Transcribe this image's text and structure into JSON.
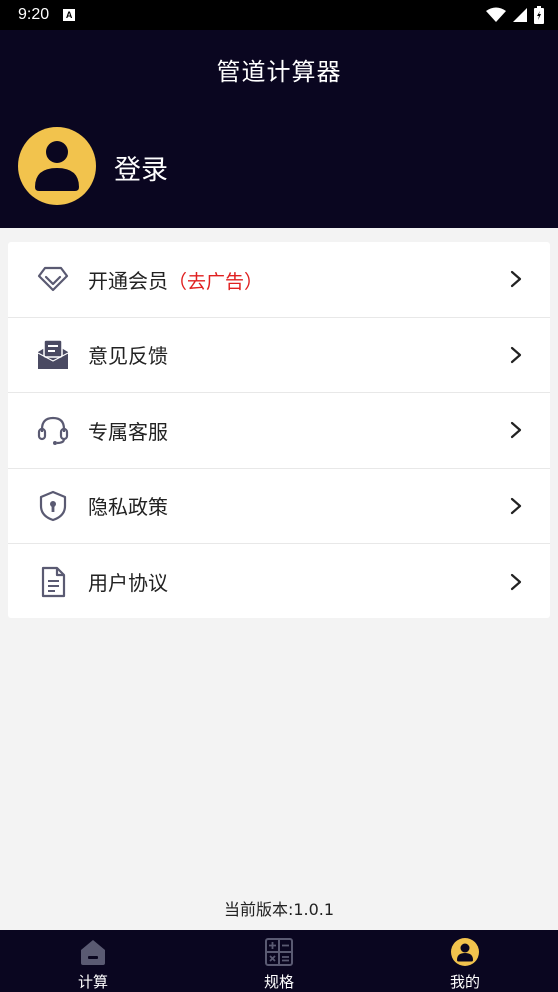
{
  "status_bar": {
    "time": "9:20",
    "a_badge": "A"
  },
  "header": {
    "title": "管道计算器",
    "login_label": "登录"
  },
  "menu": [
    {
      "icon": "diamond-icon",
      "label": "开通会员",
      "extra": "（去广告）"
    },
    {
      "icon": "feedback-mail-icon",
      "label": "意见反馈",
      "extra": ""
    },
    {
      "icon": "headset-icon",
      "label": "专属客服",
      "extra": ""
    },
    {
      "icon": "shield-lock-icon",
      "label": "隐私政策",
      "extra": ""
    },
    {
      "icon": "document-icon",
      "label": "用户协议",
      "extra": ""
    }
  ],
  "version_text": "当前版本:1.0.1",
  "tabs": [
    {
      "icon": "home-icon",
      "label": "计算",
      "active": false
    },
    {
      "icon": "calculator-icon",
      "label": "规格",
      "active": false
    },
    {
      "icon": "user-icon",
      "label": "我的",
      "active": true
    }
  ],
  "colors": {
    "header_bg": "#0a0620",
    "avatar_accent": "#f2c34d",
    "extra_red": "#e02020",
    "icon_gray": "#5a5a72"
  }
}
